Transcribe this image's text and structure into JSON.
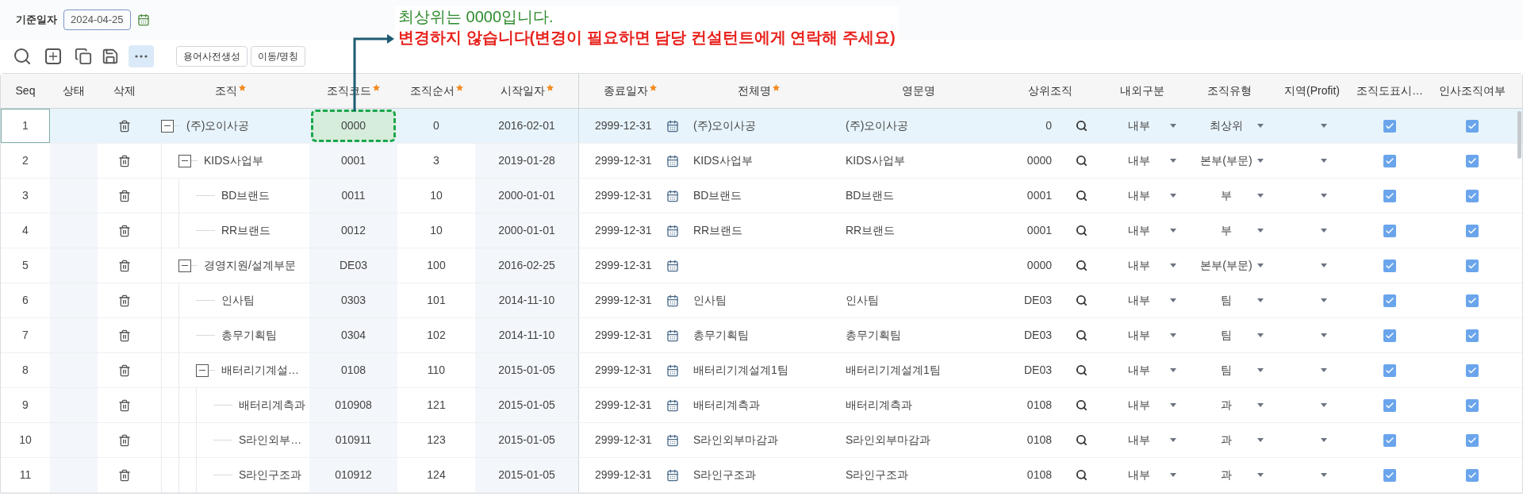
{
  "filter": {
    "label": "기준일자",
    "date": "2024-04-25"
  },
  "toolbar": {
    "text_buttons": [
      "용어사전생성",
      "이동/명칭"
    ]
  },
  "annotation": {
    "line1": "최상위는 0000입니다.",
    "line2": "변경하지 않습니다(변경이 필요하면 담당 컨설턴트에게 연락해 주세요)"
  },
  "columns": [
    {
      "label": "Seq",
      "required": false
    },
    {
      "label": "상태",
      "required": false
    },
    {
      "label": "삭제",
      "required": false
    },
    {
      "label": "조직",
      "required": true
    },
    {
      "label": "조직코드",
      "required": true
    },
    {
      "label": "조직순서",
      "required": true
    },
    {
      "label": "시작일자",
      "required": true
    },
    {
      "label": "종료일자",
      "required": true
    },
    {
      "label": "전체명",
      "required": true
    },
    {
      "label": "영문명",
      "required": false
    },
    {
      "label": "상위조직",
      "required": false
    },
    {
      "label": "내외구분",
      "required": false
    },
    {
      "label": "조직유형",
      "required": false
    },
    {
      "label": "지역(Profit)",
      "required": false
    },
    {
      "label": "조직도표시…",
      "required": false
    },
    {
      "label": "인사조직여부",
      "required": false
    }
  ],
  "rows": [
    {
      "seq": "1",
      "org": "(주)오이사공",
      "expanded": true,
      "selected": true,
      "highlighted": true,
      "code": "0000",
      "order": "0",
      "start": "2016-02-01",
      "end": "2999-12-31",
      "full_name": "(주)오이사공",
      "eng_name": "(주)오이사공",
      "parent": "0",
      "inout": "내부",
      "type": "최상위",
      "chart_display": true,
      "hr_org": true,
      "children": [
        {
          "seq": "2",
          "org": "KIDS사업부",
          "expanded": true,
          "selected": false,
          "highlighted": false,
          "code": "0001",
          "order": "3",
          "start": "2019-01-28",
          "end": "2999-12-31",
          "full_name": "KIDS사업부",
          "eng_name": "KIDS사업부",
          "parent": "0000",
          "inout": "내부",
          "type": "본부(부문)",
          "chart_display": true,
          "hr_org": true,
          "children": [
            {
              "seq": "3",
              "org": "BD브랜드",
              "selected": false,
              "highlighted": false,
              "code": "0011",
              "order": "10",
              "start": "2000-01-01",
              "end": "2999-12-31",
              "full_name": "BD브랜드",
              "eng_name": "BD브랜드",
              "parent": "0001",
              "inout": "내부",
              "type": "부",
              "chart_display": true,
              "hr_org": true
            },
            {
              "seq": "4",
              "org": "RR브랜드",
              "selected": false,
              "highlighted": false,
              "code": "0012",
              "order": "10",
              "start": "2000-01-01",
              "end": "2999-12-31",
              "full_name": "RR브랜드",
              "eng_name": "RR브랜드",
              "parent": "0001",
              "inout": "내부",
              "type": "부",
              "chart_display": true,
              "hr_org": true
            }
          ]
        },
        {
          "seq": "5",
          "org": "경영지원/설계부문",
          "expanded": true,
          "selected": false,
          "highlighted": false,
          "code": "DE03",
          "order": "100",
          "start": "2016-02-25",
          "end": "2999-12-31",
          "parent": "0000",
          "inout": "내부",
          "type": "본부(부문)",
          "chart_display": true,
          "hr_org": true,
          "children": [
            {
              "seq": "6",
              "org": "인사팀",
              "selected": false,
              "highlighted": false,
              "code": "0303",
              "order": "101",
              "start": "2014-11-10",
              "end": "2999-12-31",
              "full_name": "인사팀",
              "eng_name": "인사팀",
              "parent": "DE03",
              "inout": "내부",
              "type": "팀",
              "chart_display": true,
              "hr_org": true
            },
            {
              "seq": "7",
              "org": "총무기획팀",
              "selected": false,
              "highlighted": false,
              "code": "0304",
              "order": "102",
              "start": "2014-11-10",
              "end": "2999-12-31",
              "full_name": "총무기획팀",
              "eng_name": "총무기획팀",
              "parent": "DE03",
              "inout": "내부",
              "type": "팀",
              "chart_display": true,
              "hr_org": true
            },
            {
              "seq": "8",
              "org": "배터리기계설…",
              "expanded": true,
              "selected": false,
              "highlighted": false,
              "code": "0108",
              "order": "110",
              "start": "2015-01-05",
              "end": "2999-12-31",
              "full_name": "배터리기계설계1팀",
              "eng_name": "배터리기계설계1팀",
              "parent": "DE03",
              "inout": "내부",
              "type": "팀",
              "chart_display": true,
              "hr_org": true,
              "children": [
                {
                  "seq": "9",
                  "org": "배터리계측과",
                  "selected": false,
                  "highlighted": false,
                  "code": "010908",
                  "order": "121",
                  "start": "2015-01-05",
                  "end": "2999-12-31",
                  "full_name": "배터리계측과",
                  "eng_name": "배터리계측과",
                  "parent": "0108",
                  "inout": "내부",
                  "type": "과",
                  "chart_display": true,
                  "hr_org": true
                },
                {
                  "seq": "10",
                  "org": "S라인외부…",
                  "selected": false,
                  "highlighted": false,
                  "code": "010911",
                  "order": "123",
                  "start": "2015-01-05",
                  "end": "2999-12-31",
                  "full_name": "S라인외부마감과",
                  "eng_name": "S라인외부마감과",
                  "parent": "0108",
                  "inout": "내부",
                  "type": "과",
                  "chart_display": true,
                  "hr_org": true
                },
                {
                  "seq": "11",
                  "org": "S라인구조과",
                  "selected": false,
                  "highlighted": false,
                  "code": "010912",
                  "order": "124",
                  "start": "2015-01-05",
                  "end": "2999-12-31",
                  "full_name": "S라인구조과",
                  "eng_name": "S라인구조과",
                  "parent": "0108",
                  "inout": "내부",
                  "type": "과",
                  "chart_display": true,
                  "hr_org": true
                }
              ]
            }
          ]
        }
      ]
    }
  ]
}
